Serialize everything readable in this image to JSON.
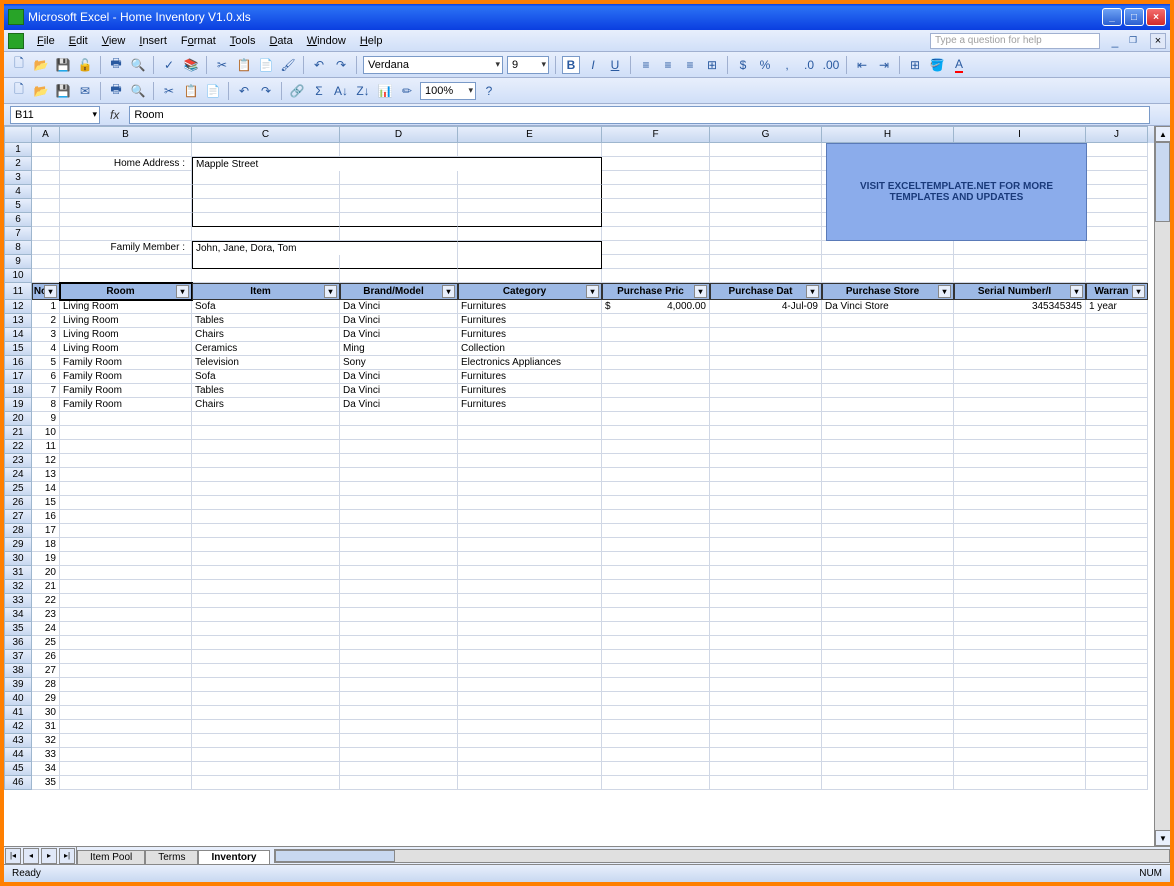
{
  "app_title": "Microsoft Excel - Home Inventory V1.0.xls",
  "menu": {
    "file": "File",
    "edit": "Edit",
    "view": "View",
    "insert": "Insert",
    "format": "Format",
    "tools": "Tools",
    "data": "Data",
    "window": "Window",
    "help": "Help"
  },
  "help_placeholder": "Type a question for help",
  "toolbar": {
    "font": "Verdana",
    "size": "9",
    "zoom": "100%"
  },
  "namebox": "B11",
  "formula": "Room",
  "columns": [
    "A",
    "B",
    "C",
    "D",
    "E",
    "F",
    "G",
    "H",
    "I",
    "J"
  ],
  "form": {
    "addr_label": "Home Address :",
    "addr_value": "Mapple Street",
    "family_label": "Family Member :",
    "family_value": "John, Jane, Dora, Tom"
  },
  "banner": "VISIT EXCELTEMPLATE.NET FOR MORE TEMPLATES AND UPDATES",
  "headers": {
    "no": "No",
    "room": "Room",
    "item": "Item",
    "brand": "Brand/Model",
    "category": "Category",
    "price": "Purchase Pric",
    "date": "Purchase Dat",
    "store": "Purchase Store",
    "serial": "Serial Number/I",
    "warranty": "Warran"
  },
  "rows": [
    {
      "no": "1",
      "room": "Living Room",
      "item": "Sofa",
      "brand": "Da Vinci",
      "category": "Furnitures",
      "price_sym": "$",
      "price": "4,000.00",
      "date": "4-Jul-09",
      "store": "Da Vinci Store",
      "serial": "345345345",
      "warranty": "1 year"
    },
    {
      "no": "2",
      "room": "Living Room",
      "item": "Tables",
      "brand": "Da Vinci",
      "category": "Furnitures",
      "price_sym": "",
      "price": "",
      "date": "",
      "store": "",
      "serial": "",
      "warranty": ""
    },
    {
      "no": "3",
      "room": "Living Room",
      "item": "Chairs",
      "brand": "Da Vinci",
      "category": "Furnitures",
      "price_sym": "",
      "price": "",
      "date": "",
      "store": "",
      "serial": "",
      "warranty": ""
    },
    {
      "no": "4",
      "room": "Living Room",
      "item": "Ceramics",
      "brand": "Ming",
      "category": "Collection",
      "price_sym": "",
      "price": "",
      "date": "",
      "store": "",
      "serial": "",
      "warranty": ""
    },
    {
      "no": "5",
      "room": "Family Room",
      "item": "Television",
      "brand": "Sony",
      "category": "Electronics Appliances",
      "price_sym": "",
      "price": "",
      "date": "",
      "store": "",
      "serial": "",
      "warranty": ""
    },
    {
      "no": "6",
      "room": "Family Room",
      "item": "Sofa",
      "brand": "Da Vinci",
      "category": "Furnitures",
      "price_sym": "",
      "price": "",
      "date": "",
      "store": "",
      "serial": "",
      "warranty": ""
    },
    {
      "no": "7",
      "room": "Family Room",
      "item": "Tables",
      "brand": "Da Vinci",
      "category": "Furnitures",
      "price_sym": "",
      "price": "",
      "date": "",
      "store": "",
      "serial": "",
      "warranty": ""
    },
    {
      "no": "8",
      "room": "Family Room",
      "item": "Chairs",
      "brand": "Da Vinci",
      "category": "Furnitures",
      "price_sym": "",
      "price": "",
      "date": "",
      "store": "",
      "serial": "",
      "warranty": ""
    }
  ],
  "empty_start_no": 9,
  "empty_count": 27,
  "first_row_num": 1,
  "last_row_num": 46,
  "tabs": [
    "Item Pool",
    "Terms",
    "Inventory"
  ],
  "active_tab": "Inventory",
  "status": {
    "left": "Ready",
    "right": "NUM"
  }
}
